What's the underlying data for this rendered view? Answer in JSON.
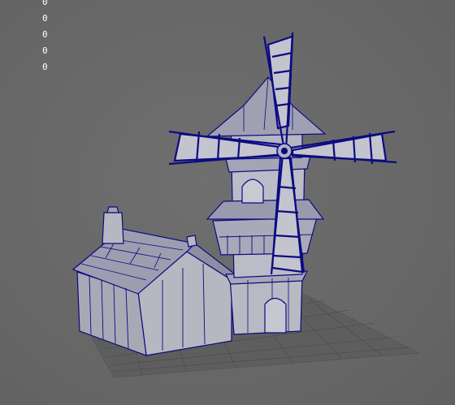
{
  "viewport": {
    "label": "3D viewport",
    "background_color": "#666666",
    "wire_color": "#0b0b80",
    "surface_color": "#b9b9c4"
  },
  "hud": {
    "values": [
      "0",
      "0",
      "0",
      "0",
      "0"
    ]
  },
  "scene": {
    "objects": [
      "windmill",
      "cottage",
      "ground-grid"
    ]
  }
}
